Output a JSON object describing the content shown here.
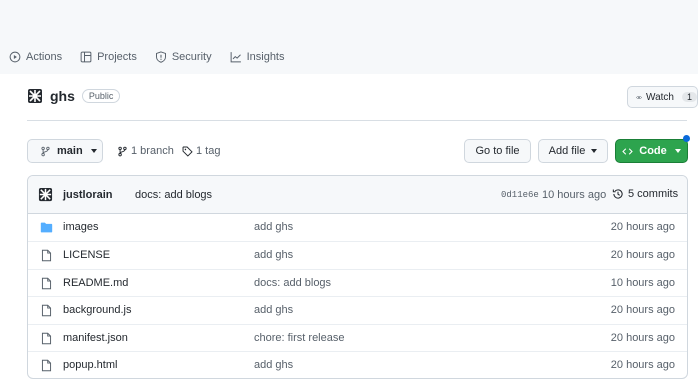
{
  "nav": {
    "tabs": [
      {
        "label": "Actions",
        "icon": "play-circle-icon"
      },
      {
        "label": "Projects",
        "icon": "table-icon"
      },
      {
        "label": "Security",
        "icon": "shield-icon"
      },
      {
        "label": "Insights",
        "icon": "graph-icon"
      }
    ]
  },
  "repo": {
    "name": "ghs",
    "visibility": "Public",
    "watch_label": "Watch",
    "watch_count": "1"
  },
  "toolbar": {
    "branch": "main",
    "branches": "1 branch",
    "tags": "1 tag",
    "go_to_file": "Go to file",
    "add_file": "Add file",
    "code": "Code"
  },
  "commit": {
    "author": "justlorain",
    "message": "docs: add blogs",
    "sha": "0d11e6e",
    "time": "10 hours ago",
    "count": "5 commits"
  },
  "files": [
    {
      "name": "images",
      "type": "folder",
      "message": "add ghs",
      "time": "20 hours ago"
    },
    {
      "name": "LICENSE",
      "type": "file",
      "message": "add ghs",
      "time": "20 hours ago"
    },
    {
      "name": "README.md",
      "type": "file",
      "message": "docs: add blogs",
      "time": "10 hours ago"
    },
    {
      "name": "background.js",
      "type": "file",
      "message": "add ghs",
      "time": "20 hours ago"
    },
    {
      "name": "manifest.json",
      "type": "file",
      "message": "chore: first release",
      "time": "20 hours ago"
    },
    {
      "name": "popup.html",
      "type": "file",
      "message": "add ghs",
      "time": "20 hours ago"
    }
  ],
  "colors": {
    "accent_green": "#2da44e",
    "folder_blue": "#54aeff",
    "notification_blue": "#0969da"
  }
}
